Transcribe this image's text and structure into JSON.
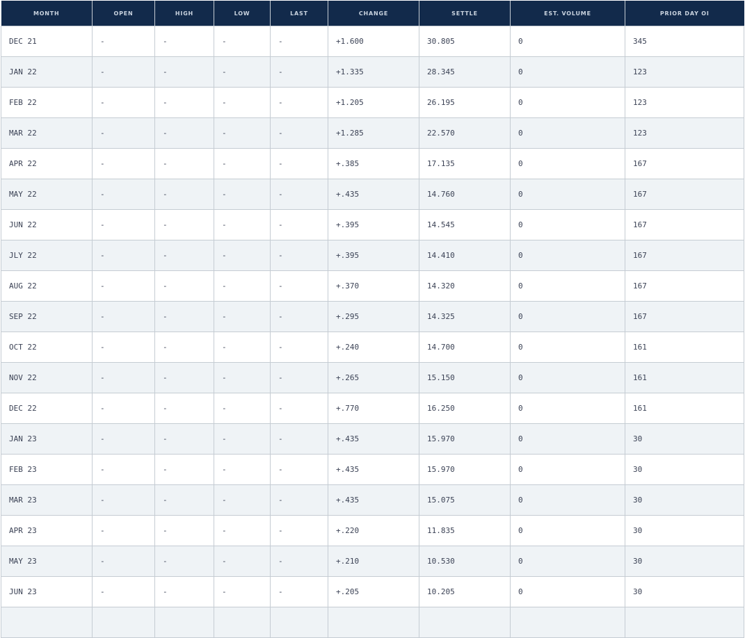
{
  "columns": [
    "MONTH",
    "OPEN",
    "HIGH",
    "LOW",
    "LAST",
    "CHANGE",
    "SETTLE",
    "EST. VOLUME",
    "PRIOR DAY OI"
  ],
  "rows": [
    [
      "DEC 21",
      "-",
      "-",
      "-",
      "-",
      "+1.600",
      "30.805",
      "0",
      "345"
    ],
    [
      "JAN 22",
      "-",
      "-",
      "-",
      "-",
      "+1.335",
      "28.345",
      "0",
      "123"
    ],
    [
      "FEB 22",
      "-",
      "-",
      "-",
      "-",
      "+1.205",
      "26.195",
      "0",
      "123"
    ],
    [
      "MAR 22",
      "-",
      "-",
      "-",
      "-",
      "+1.285",
      "22.570",
      "0",
      "123"
    ],
    [
      "APR 22",
      "-",
      "-",
      "-",
      "-",
      "+.385",
      "17.135",
      "0",
      "167"
    ],
    [
      "MAY 22",
      "-",
      "-",
      "-",
      "-",
      "+.435",
      "14.760",
      "0",
      "167"
    ],
    [
      "JUN 22",
      "-",
      "-",
      "-",
      "-",
      "+.395",
      "14.545",
      "0",
      "167"
    ],
    [
      "JLY 22",
      "-",
      "-",
      "-",
      "-",
      "+.395",
      "14.410",
      "0",
      "167"
    ],
    [
      "AUG 22",
      "-",
      "-",
      "-",
      "-",
      "+.370",
      "14.320",
      "0",
      "167"
    ],
    [
      "SEP 22",
      "-",
      "-",
      "-",
      "-",
      "+.295",
      "14.325",
      "0",
      "167"
    ],
    [
      "OCT 22",
      "-",
      "-",
      "-",
      "-",
      "+.240",
      "14.700",
      "0",
      "161"
    ],
    [
      "NOV 22",
      "-",
      "-",
      "-",
      "-",
      "+.265",
      "15.150",
      "0",
      "161"
    ],
    [
      "DEC 22",
      "-",
      "-",
      "-",
      "-",
      "+.770",
      "16.250",
      "0",
      "161"
    ],
    [
      "JAN 23",
      "-",
      "-",
      "-",
      "-",
      "+.435",
      "15.970",
      "0",
      "30"
    ],
    [
      "FEB 23",
      "-",
      "-",
      "-",
      "-",
      "+.435",
      "15.970",
      "0",
      "30"
    ],
    [
      "MAR 23",
      "-",
      "-",
      "-",
      "-",
      "+.435",
      "15.075",
      "0",
      "30"
    ],
    [
      "APR 23",
      "-",
      "-",
      "-",
      "-",
      "+.220",
      "11.835",
      "0",
      "30"
    ],
    [
      "MAY 23",
      "-",
      "-",
      "-",
      "-",
      "+.210",
      "10.530",
      "0",
      "30"
    ],
    [
      "JUN 23",
      "-",
      "-",
      "-",
      "-",
      "+.205",
      "10.205",
      "0",
      "30"
    ]
  ]
}
